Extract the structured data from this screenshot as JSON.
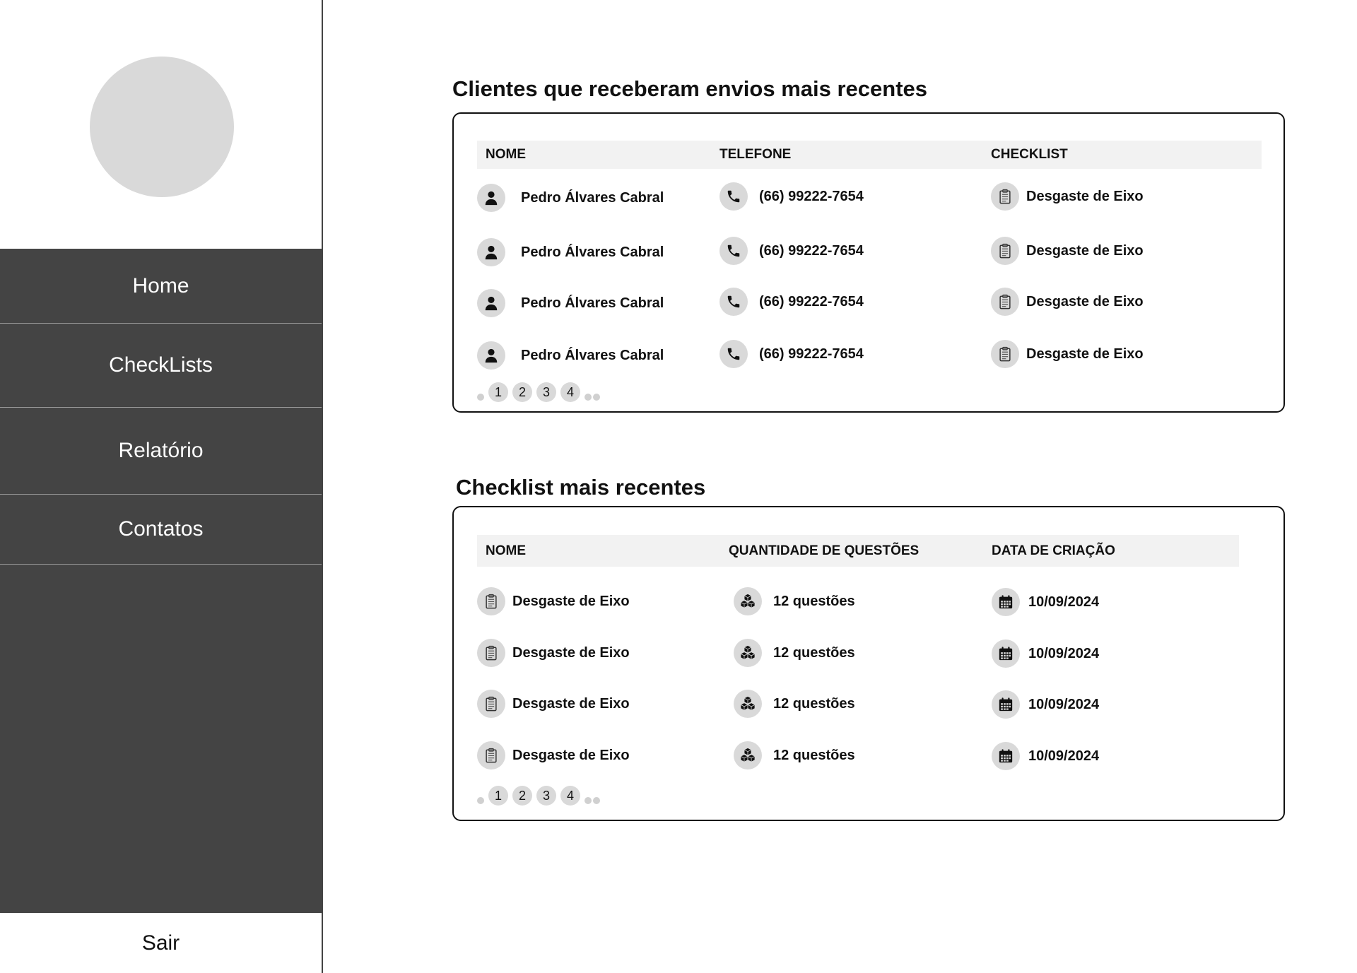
{
  "sidebar": {
    "nav": [
      {
        "label": "Home"
      },
      {
        "label": "CheckLists"
      },
      {
        "label": "Relatório"
      },
      {
        "label": "Contatos"
      }
    ],
    "logout_label": "Sair"
  },
  "clients_section": {
    "title": "Clientes que receberam envios mais recentes",
    "columns": [
      "NOME",
      "TELEFONE",
      "CHECKLIST"
    ],
    "rows": [
      {
        "name": "Pedro Álvares Cabral",
        "phone": "(66) 99222-7654",
        "checklist": "Desgaste de Eixo"
      },
      {
        "name": "Pedro Álvares Cabral",
        "phone": "(66) 99222-7654",
        "checklist": "Desgaste de Eixo"
      },
      {
        "name": "Pedro Álvares Cabral",
        "phone": "(66) 99222-7654",
        "checklist": "Desgaste de Eixo"
      },
      {
        "name": "Pedro Álvares Cabral",
        "phone": "(66) 99222-7654",
        "checklist": "Desgaste de Eixo"
      }
    ],
    "pages": [
      "1",
      "2",
      "3",
      "4"
    ]
  },
  "checklists_section": {
    "title": "Checklist mais recentes",
    "columns": [
      "NOME",
      "QUANTIDADE DE QUESTÕES",
      "DATA DE CRIAÇÃO"
    ],
    "rows": [
      {
        "name": "Desgaste de Eixo",
        "questions": "12 questões",
        "date": "10/09/2024"
      },
      {
        "name": "Desgaste de Eixo",
        "questions": "12 questões",
        "date": "10/09/2024"
      },
      {
        "name": "Desgaste de Eixo",
        "questions": "12 questões",
        "date": "10/09/2024"
      },
      {
        "name": "Desgaste de Eixo",
        "questions": "12 questões",
        "date": "10/09/2024"
      }
    ],
    "pages": [
      "1",
      "2",
      "3",
      "4"
    ]
  },
  "icons": {
    "client": "user-icon",
    "phone": "phone-icon",
    "checklist": "clipboard-icon",
    "questions": "cubes-icon",
    "date": "calendar-icon"
  },
  "colors": {
    "sidebar_bg": "#444444",
    "avatar_bg": "#d9d9d9",
    "table_header_bg": "#f2f2f2",
    "icon_bg": "#d9d9d9"
  }
}
